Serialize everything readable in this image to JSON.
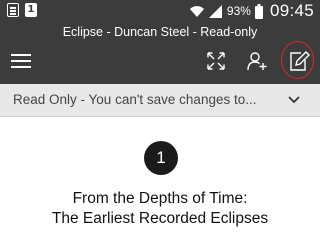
{
  "status_bar": {
    "notification_icons": [
      "document-icon",
      "calendar-icon"
    ],
    "calendar_day": "1",
    "battery_percent": "93%",
    "time": "09:45"
  },
  "app_bar": {
    "title": "Eclipse - Duncan Steel - Read-only",
    "actions": [
      "menu-icon",
      "fullscreen-icon",
      "add-person-icon",
      "edit-icon"
    ],
    "highlight_color": "#e0282a"
  },
  "banner": {
    "text": "Read Only - You can't save changes to..."
  },
  "document": {
    "chapter_number": "1",
    "chapter_title_line1": "From the Depths of Time:",
    "chapter_title_line2": "The Earliest Recorded Eclipses"
  },
  "colors": {
    "toolbar": "#3c3c3c",
    "banner": "#e8e8e8"
  }
}
